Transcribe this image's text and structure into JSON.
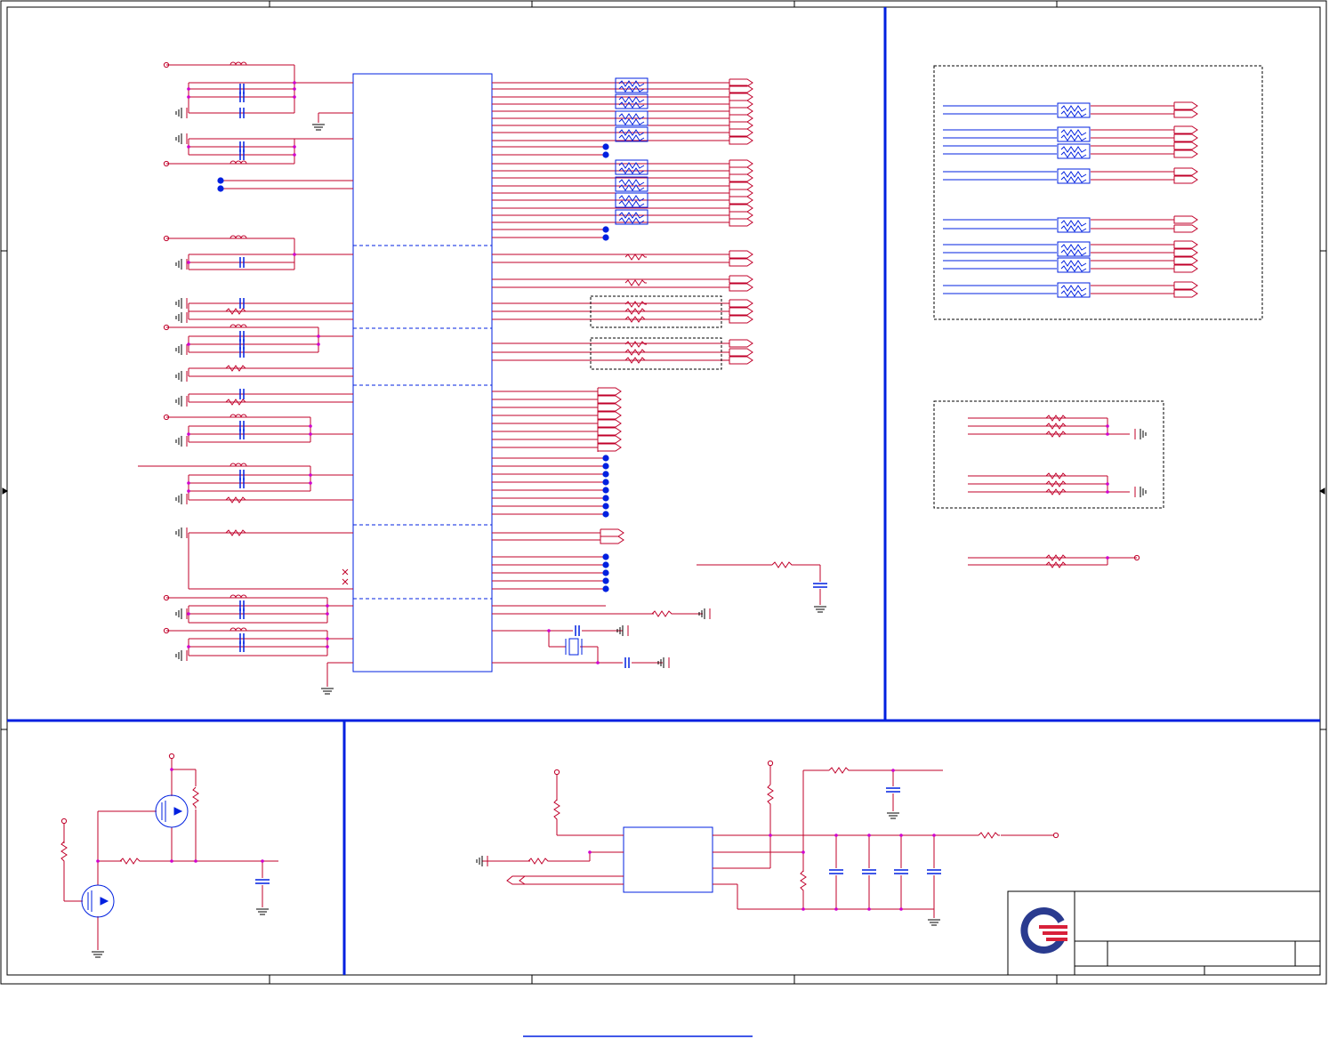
{
  "sheet": {
    "kind": "schematic",
    "colors": {
      "net": "#c0002a",
      "bus": "#0020e0",
      "junction": "#d000d0",
      "border": "#000000",
      "logo_blue": "#2a3b8f",
      "logo_red": "#d8213a"
    },
    "icons": [
      "company-logo",
      "ground-icon",
      "resistor-icon",
      "capacitor-icon",
      "inductor-icon",
      "mosfet-icon",
      "crystal-icon",
      "off-page-connector-icon"
    ]
  }
}
